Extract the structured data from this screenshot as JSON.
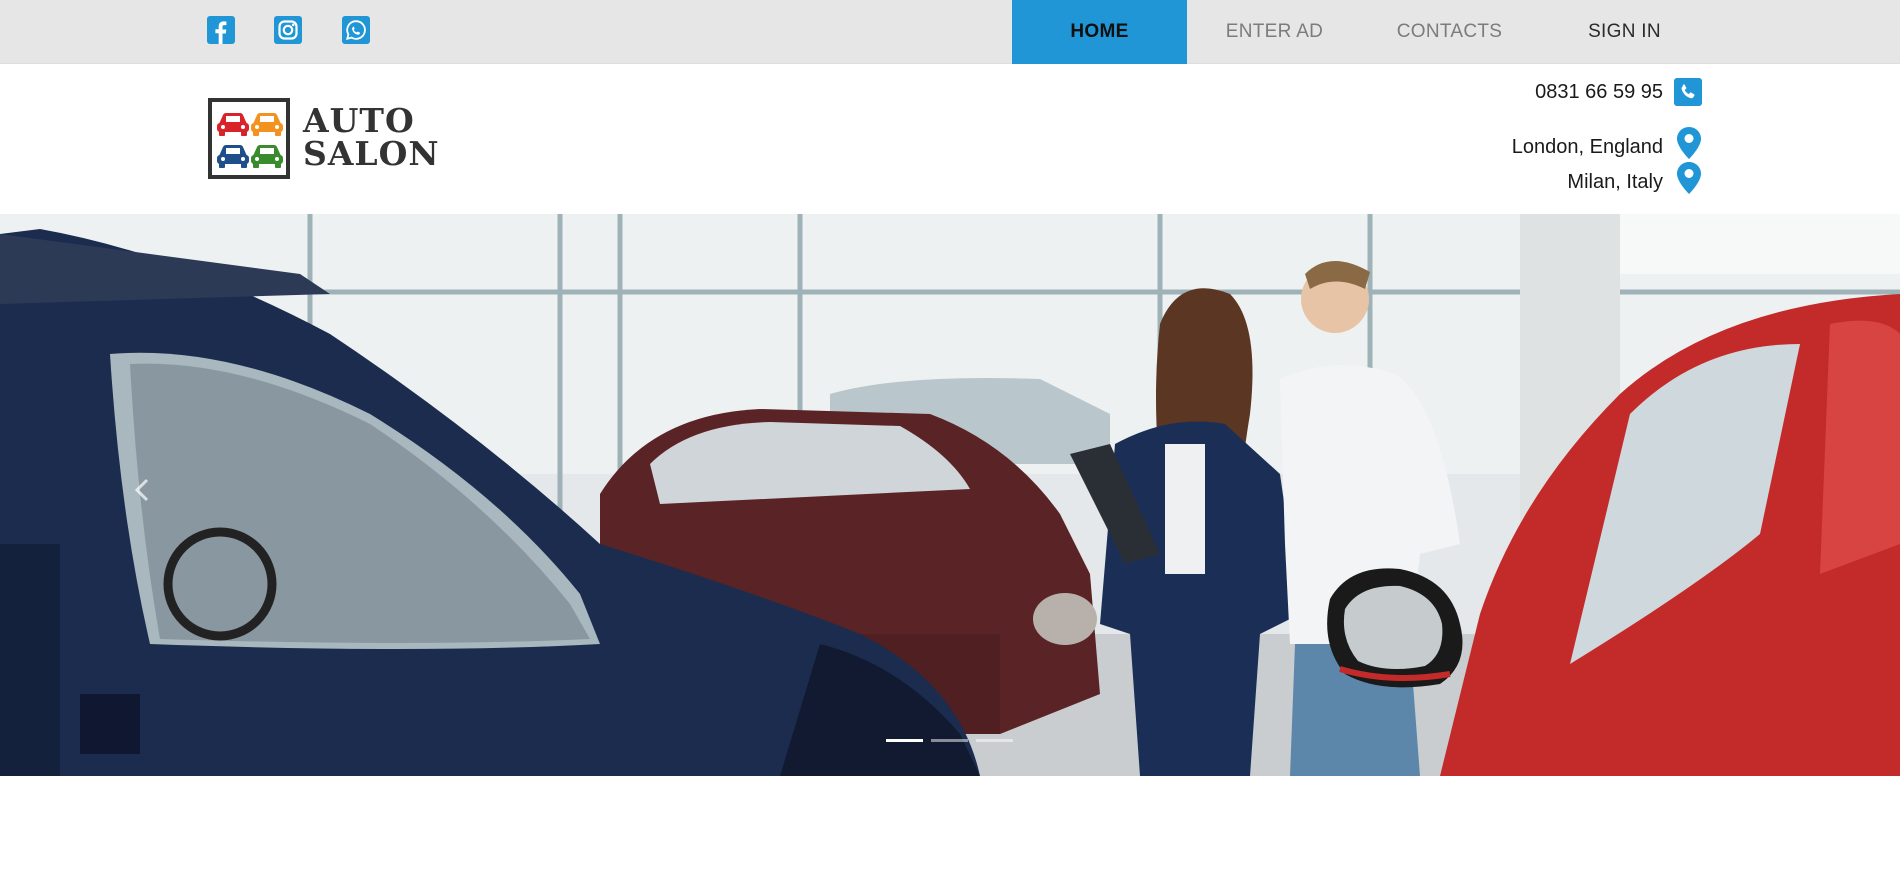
{
  "colors": {
    "accent": "#2196d6",
    "topbar_bg": "#e6e6e6"
  },
  "social": [
    {
      "name": "facebook-icon"
    },
    {
      "name": "instagram-icon"
    },
    {
      "name": "whatsapp-icon"
    }
  ],
  "nav": {
    "home": "HOME",
    "enter_ad": "ENTER AD",
    "contacts": "CONTACTS",
    "sign_in": "SIGN IN"
  },
  "logo": {
    "line1": "AUTO",
    "line2": "SALON"
  },
  "contact": {
    "phone": "0831 66 59 95",
    "location1": "London, England",
    "location2": "Milan, Italy"
  },
  "carousel": {
    "slides": 3,
    "active_slide": 1
  }
}
